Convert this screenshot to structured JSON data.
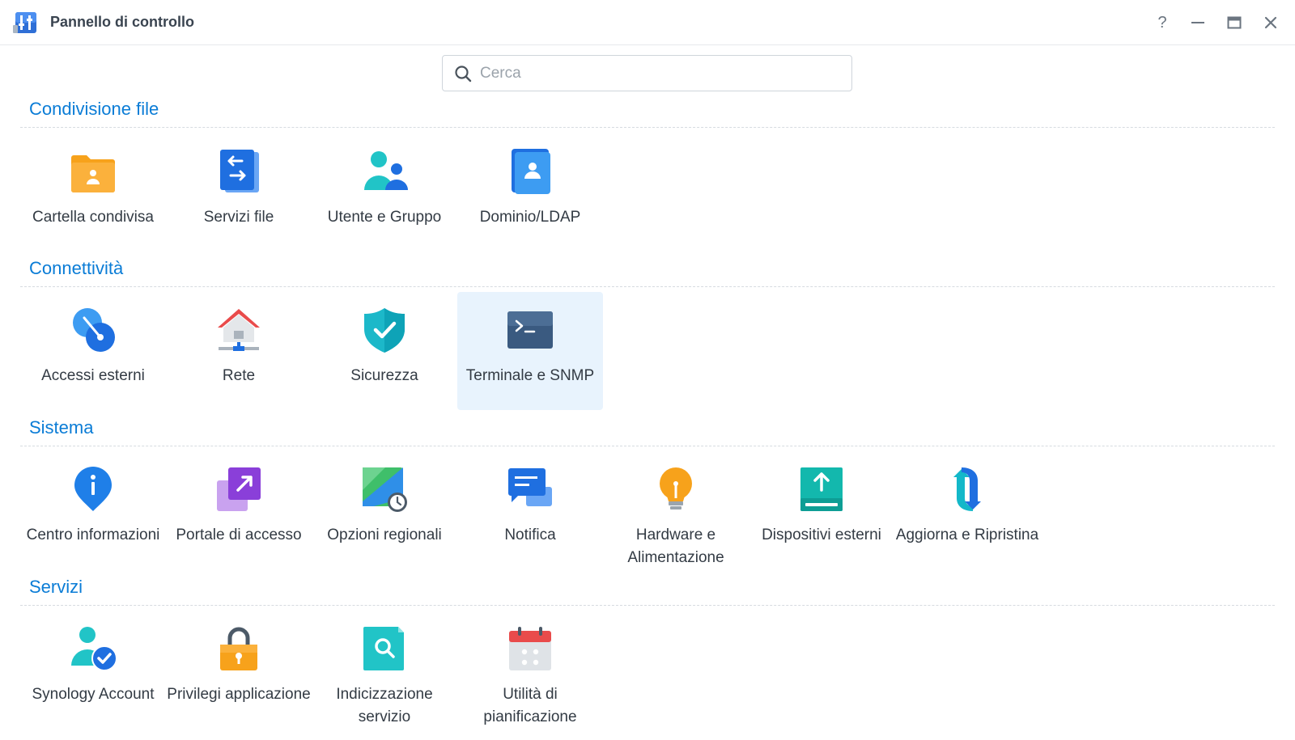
{
  "window": {
    "title": "Pannello di controllo",
    "controls": {
      "help": "?"
    }
  },
  "search": {
    "placeholder": "Cerca",
    "value": ""
  },
  "sections": [
    {
      "title": "Condivisione file",
      "items": [
        {
          "label": "Cartella condivisa",
          "icon": "shared-folder-icon"
        },
        {
          "label": "Servizi file",
          "icon": "file-services-icon"
        },
        {
          "label": "Utente e Gruppo",
          "icon": "user-group-icon"
        },
        {
          "label": "Dominio/LDAP",
          "icon": "domain-ldap-icon"
        }
      ]
    },
    {
      "title": "Connettività",
      "items": [
        {
          "label": "Accessi esterni",
          "icon": "external-access-icon"
        },
        {
          "label": "Rete",
          "icon": "network-icon"
        },
        {
          "label": "Sicurezza",
          "icon": "security-shield-icon"
        },
        {
          "label": "Terminale e SNMP",
          "icon": "terminal-icon",
          "selected": true
        }
      ]
    },
    {
      "title": "Sistema",
      "items": [
        {
          "label": "Centro informazioni",
          "icon": "info-center-icon"
        },
        {
          "label": "Portale di accesso",
          "icon": "login-portal-icon"
        },
        {
          "label": "Opzioni regionali",
          "icon": "regional-options-icon"
        },
        {
          "label": "Notifica",
          "icon": "notification-icon"
        },
        {
          "label": "Hardware e Alimentazione",
          "icon": "hardware-power-icon"
        },
        {
          "label": "Dispositivi esterni",
          "icon": "external-devices-icon"
        },
        {
          "label": "Aggiorna e Ripristina",
          "icon": "update-restore-icon"
        }
      ]
    },
    {
      "title": "Servizi",
      "items": [
        {
          "label": "Synology Account",
          "icon": "synology-account-icon"
        },
        {
          "label": "Privilegi applicazione",
          "icon": "application-privileges-icon"
        },
        {
          "label": "Indicizzazione servizio",
          "icon": "indexing-service-icon"
        },
        {
          "label": "Utilità di pianificazione",
          "icon": "task-scheduler-icon"
        }
      ]
    }
  ],
  "colors": {
    "section_title": "#0a7cd6",
    "selected_bg": "#e8f3fd",
    "text": "#333b44"
  }
}
